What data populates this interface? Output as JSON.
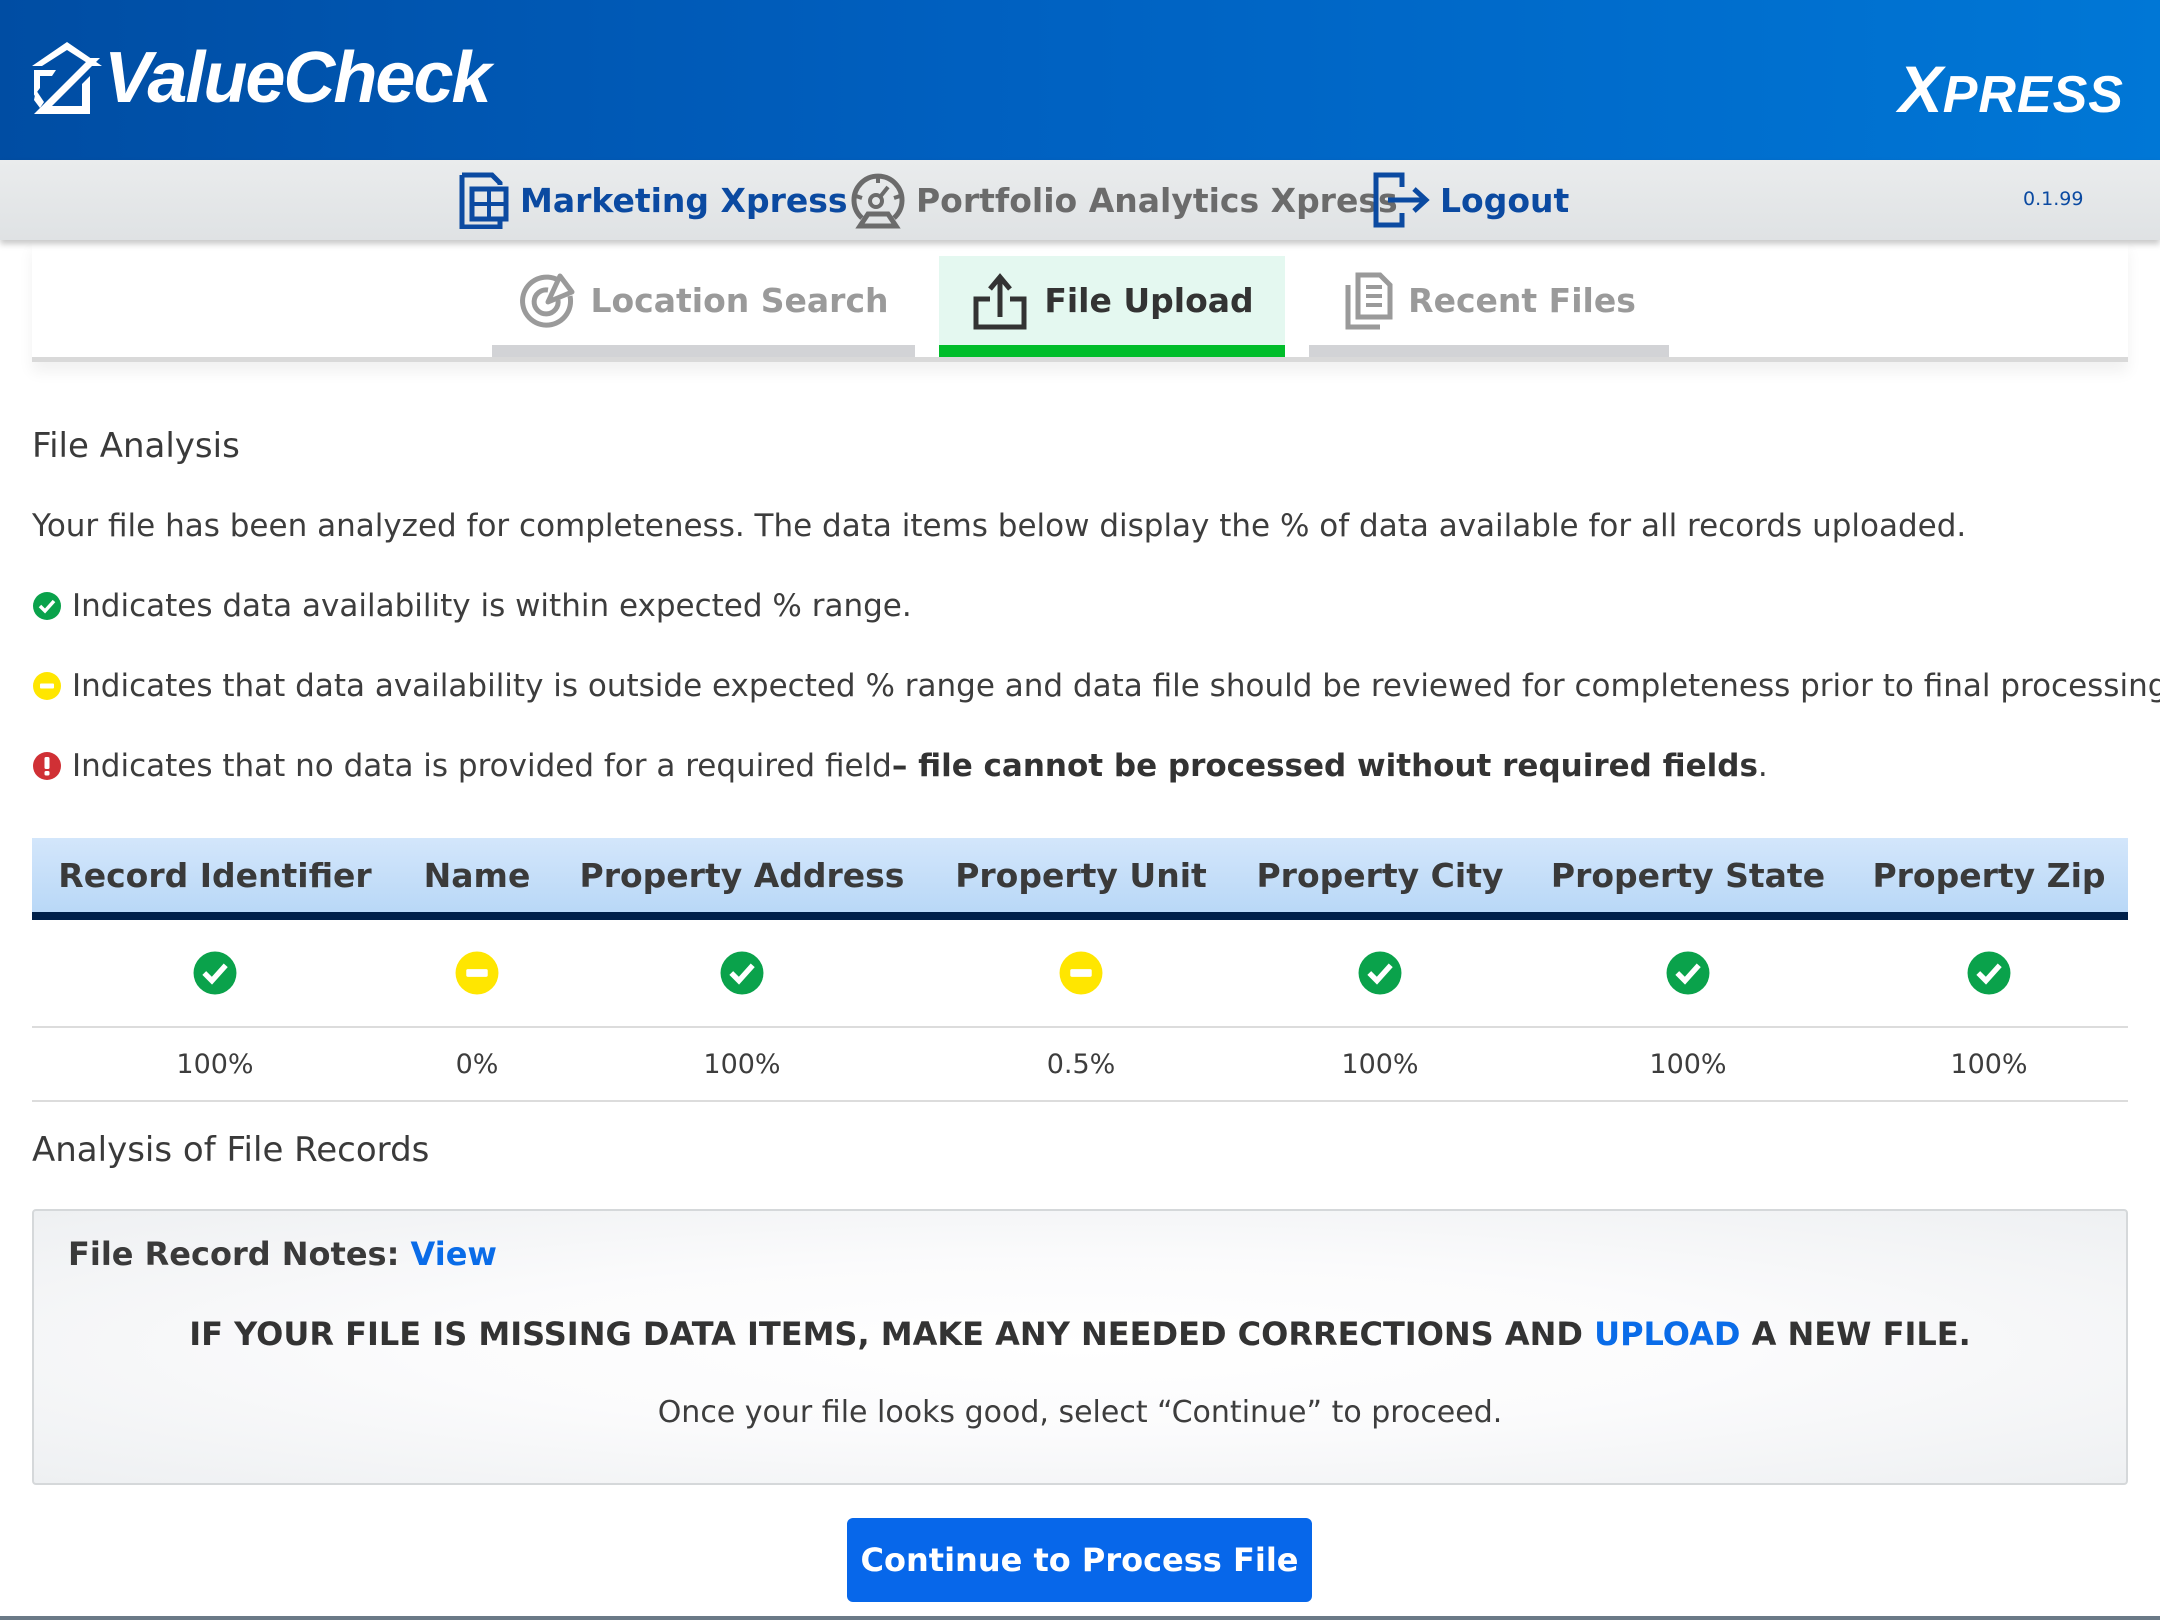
{
  "header": {
    "logo_text": "ValueCheck",
    "product_first_letter": "X",
    "product_rest": "PRESS"
  },
  "nav": {
    "items": [
      {
        "label": "Marketing Xpress",
        "icon": "spreadsheet-icon",
        "active": true
      },
      {
        "label": "Portfolio Analytics Xpress",
        "icon": "gauge-icon",
        "active": false
      },
      {
        "label": "Logout",
        "icon": "logout-icon",
        "active": true
      }
    ],
    "version": "0.1.99"
  },
  "tabs": [
    {
      "label": "Location Search",
      "icon": "target-icon",
      "selected": false
    },
    {
      "label": "File Upload",
      "icon": "upload-icon",
      "selected": true
    },
    {
      "label": "Recent Files",
      "icon": "documents-icon",
      "selected": false
    }
  ],
  "file_analysis": {
    "title": "File Analysis",
    "intro": "Your file has been analyzed for completeness. The data items below display the % of data available for all records uploaded.",
    "legend": {
      "ok": "Indicates data availability is within expected % range.",
      "warn": "Indicates that data availability is outside expected % range and data file should be reviewed for completeness prior to final processing.",
      "error_prefix": "Indicates that no data is provided for a required field ",
      "error_bold": "– file cannot be processed without required fields",
      "error_suffix": "."
    },
    "colors": {
      "ok": "#0aa24b",
      "warn": "#ffe600",
      "error": "#d03035"
    }
  },
  "table": {
    "columns": [
      {
        "header": "Record Identifier",
        "status": "ok",
        "value": "100%"
      },
      {
        "header": "Name",
        "status": "warn",
        "value": "0%"
      },
      {
        "header": "Property Address",
        "status": "ok",
        "value": "100%"
      },
      {
        "header": "Property Unit",
        "status": "warn",
        "value": "0.5%"
      },
      {
        "header": "Property City",
        "status": "ok",
        "value": "100%"
      },
      {
        "header": "Property State",
        "status": "ok",
        "value": "100%"
      },
      {
        "header": "Property Zip",
        "status": "ok",
        "value": "100%"
      }
    ]
  },
  "records": {
    "title": "Analysis of File Records",
    "notes_label": "File Record Notes:",
    "notes_link": "View",
    "missing_prefix": "IF YOUR FILE IS MISSING DATA ITEMS, MAKE ANY NEEDED CORRECTIONS AND ",
    "missing_link": "UPLOAD",
    "missing_suffix": " A NEW FILE.",
    "once_text": "Once your file looks good, select “Continue” to proceed."
  },
  "actions": {
    "continue_label": "Continue to Process File"
  }
}
